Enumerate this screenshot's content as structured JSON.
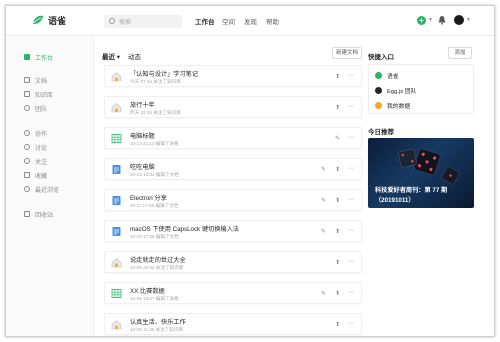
{
  "app": {
    "name": "语雀",
    "brand_color": "#25b864"
  },
  "search": {
    "placeholder": "搜索"
  },
  "nav": [
    {
      "label": "工作台",
      "active": true
    },
    {
      "label": "空间"
    },
    {
      "label": "发现"
    },
    {
      "label": "帮助"
    }
  ],
  "header_icons": [
    "plus-icon",
    "bell-icon",
    "avatar"
  ],
  "sidebar": {
    "items": [
      {
        "label": "工作台",
        "icon": "dashboard-icon"
      },
      {
        "label": "文档",
        "icon": "document-icon"
      },
      {
        "label": "知识库",
        "icon": "book-icon"
      },
      {
        "label": "团队",
        "icon": "team-icon"
      },
      {
        "label": "协作",
        "icon": "collaborate-icon"
      },
      {
        "label": "讨论",
        "icon": "comment-icon"
      },
      {
        "label": "关注",
        "icon": "heart-icon"
      },
      {
        "label": "收藏",
        "icon": "star-icon"
      },
      {
        "label": "最近浏览",
        "icon": "clock-icon"
      },
      {
        "label": "回收站",
        "icon": "trash-icon"
      }
    ]
  },
  "main": {
    "filter_label": "最近 ▾",
    "section_label": "动态",
    "new_doc_button": "新建文档",
    "rows": [
      {
        "title": "「认知与设计」学习笔记",
        "meta": "今天 07:44 关注了知识库",
        "icon": "house-icon"
      },
      {
        "title": "旅行十年",
        "meta": "昨天 22:39 关注了知识库",
        "icon": "house-icon"
      },
      {
        "title": "电脑标题",
        "meta": "10-13 21:13 编辑了表格",
        "icon": "sheet-icon"
      },
      {
        "title": "吃吃电脑",
        "meta": "10-13 13:34 编辑了文档",
        "icon": "doc-icon"
      },
      {
        "title": "Electron 分享",
        "meta": "10-11 17:56 编辑了文档",
        "icon": "doc-icon"
      },
      {
        "title": "macOS 下使用 CapsLock 键切换输入法",
        "meta": "10-10 17:25 编辑了文档",
        "icon": "doc-icon"
      },
      {
        "title": "说走就走的世过大全",
        "meta": "10-09 20:44 关注了知识库",
        "icon": "house-icon"
      },
      {
        "title": "XX 比赛数据",
        "meta": "10-09 16:37 编辑了表格",
        "icon": "sheet-icon"
      },
      {
        "title": "认真生活、快乐工作",
        "meta": "10-09 11:36 关注了知识库",
        "icon": "house-icon"
      }
    ]
  },
  "right": {
    "quick_title": "快捷入口",
    "add_button": "添加",
    "quick_items": [
      {
        "label": "语雀",
        "color": "#25b864"
      },
      {
        "label": "Egg.js 团队",
        "color": "#262626"
      },
      {
        "label": "我的数据",
        "color": "#f5a623"
      }
    ],
    "recommend_title": "今日推荐",
    "recommend_caption1": "科技爱好者周刊：第 77 期",
    "recommend_caption2": "（20191011）"
  }
}
